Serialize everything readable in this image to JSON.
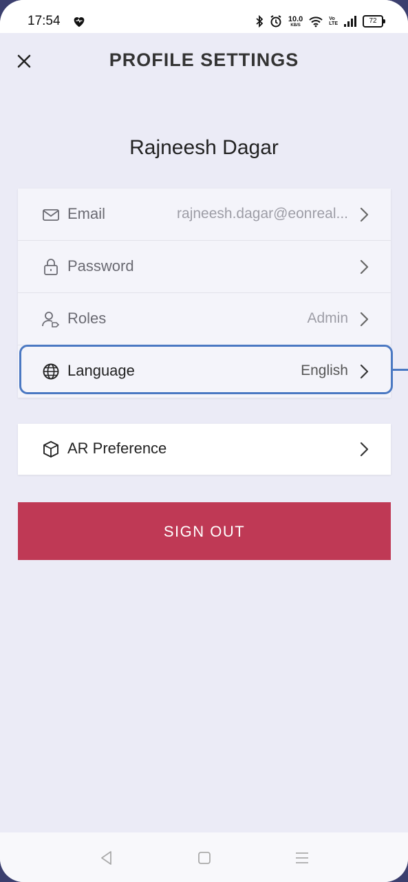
{
  "status_bar": {
    "time": "17:54",
    "speed_value": "10.0",
    "speed_unit": "KB/S",
    "volte_top": "Vo",
    "volte_bottom": "LTE",
    "battery": "72"
  },
  "header": {
    "title": "PROFILE SETTINGS"
  },
  "profile": {
    "name": "Rajneesh Dagar"
  },
  "settings": {
    "rows": [
      {
        "label": "Email",
        "value": "rajneesh.dagar@eonreal...",
        "icon": "envelope-icon"
      },
      {
        "label": "Password",
        "value": "",
        "icon": "lock-icon"
      },
      {
        "label": "Roles",
        "value": "Admin",
        "icon": "user-tag-icon"
      },
      {
        "label": "Language",
        "value": "English",
        "icon": "globe-icon"
      }
    ],
    "ar": {
      "label": "AR Preference",
      "icon": "cube-icon"
    }
  },
  "actions": {
    "sign_out": "SIGN OUT"
  },
  "colors": {
    "accent": "#bf3955",
    "highlight": "#4a78c2",
    "background": "#ebebf6"
  }
}
